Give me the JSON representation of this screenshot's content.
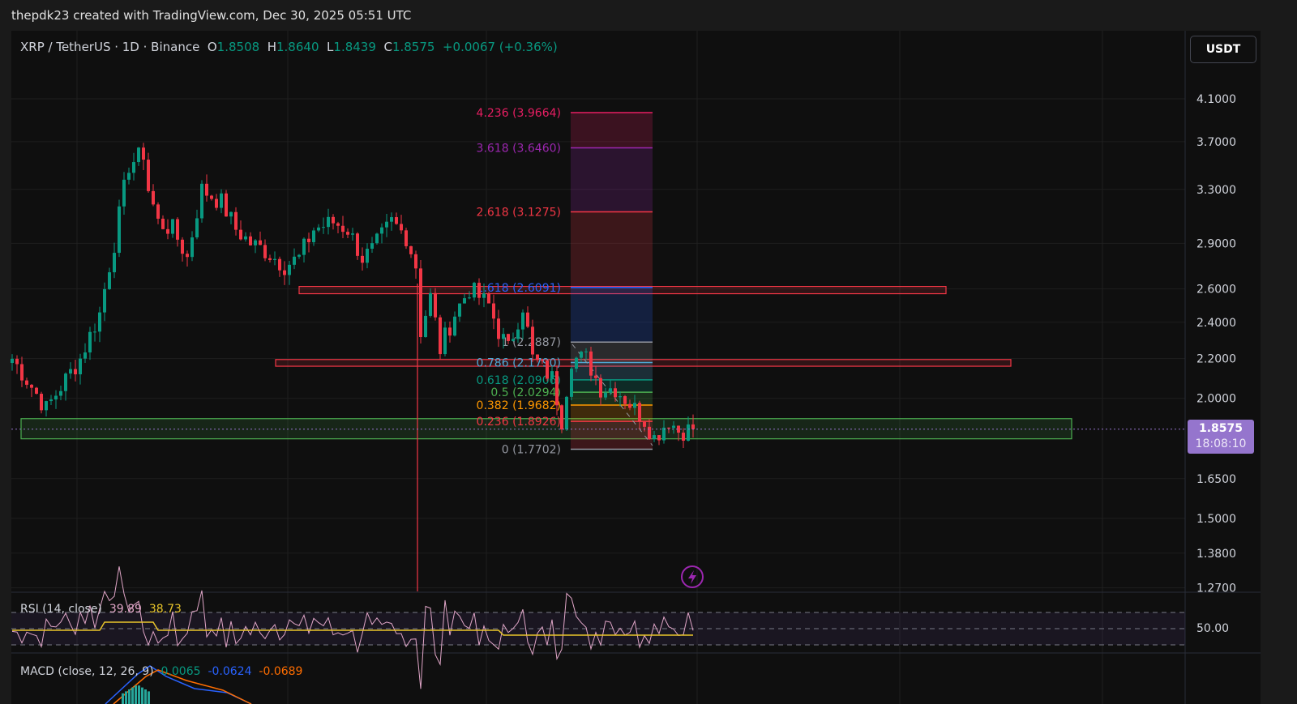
{
  "credit": "thepdk23 created with TradingView.com, Dec 30, 2025 05:51 UTC",
  "legend": {
    "symbol": "XRP / TetherUS · 1D · Binance",
    "o_label": "O",
    "o": "1.8508",
    "h_label": "H",
    "h": "1.8640",
    "l_label": "L",
    "l": "1.8439",
    "c_label": "C",
    "c": "1.8575",
    "change": "+0.0067 (+0.36%)"
  },
  "currency_button": "USDT",
  "price_tag": {
    "price": "1.8575",
    "countdown": "18:08:10"
  },
  "rsi": {
    "label": "RSI (14, close)",
    "value": "39.89",
    "ma": "38.73",
    "axis": "50.00"
  },
  "macd": {
    "label": "MACD (close, 12, 26, 9)",
    "hist": "0.0065",
    "macd": "-0.0624",
    "signal": "-0.0689"
  },
  "colors": {
    "up": "#089981",
    "down": "#f23645",
    "rsi": "#e1a6c8",
    "rsi_ma": "#e9c52a",
    "macd": "#2962ff",
    "signal": "#ff6d00"
  },
  "chart_data": {
    "type": "candlestick",
    "title": "XRP / TetherUS · 1D · Binance",
    "scale": "log",
    "y_ticks": [
      "4.1000",
      "3.7000",
      "3.3000",
      "2.9000",
      "2.6000",
      "2.4000",
      "2.2000",
      "2.0000",
      "1.6500",
      "1.5000",
      "1.3800",
      "1.2700"
    ],
    "ylim": [
      1.25,
      4.3
    ],
    "close_keyframes": [
      [
        0,
        2.2
      ],
      [
        7,
        1.95
      ],
      [
        14,
        2.2
      ],
      [
        18,
        2.45
      ],
      [
        21,
        2.9
      ],
      [
        24,
        3.5
      ],
      [
        27,
        3.6
      ],
      [
        28,
        3.3
      ],
      [
        30,
        3.05
      ],
      [
        33,
        3.0
      ],
      [
        36,
        2.8
      ],
      [
        39,
        3.3
      ],
      [
        43,
        3.2
      ],
      [
        46,
        3.0
      ],
      [
        49,
        2.9
      ],
      [
        52,
        2.85
      ],
      [
        56,
        2.75
      ],
      [
        59,
        2.8
      ],
      [
        62,
        3.0
      ],
      [
        66,
        3.05
      ],
      [
        69,
        3.0
      ],
      [
        72,
        2.8
      ],
      [
        74,
        2.85
      ],
      [
        78,
        3.05
      ],
      [
        81,
        2.95
      ],
      [
        83,
        2.75
      ],
      [
        84,
        2.35
      ],
      [
        86,
        2.55
      ],
      [
        88,
        2.25
      ],
      [
        91,
        2.45
      ],
      [
        94,
        2.6
      ],
      [
        98,
        2.5
      ],
      [
        100,
        2.35
      ],
      [
        102,
        2.25
      ],
      [
        105,
        2.5
      ],
      [
        107,
        2.2
      ],
      [
        111,
        2.1
      ],
      [
        113,
        1.9
      ],
      [
        115,
        2.2
      ],
      [
        118,
        2.2
      ],
      [
        121,
        2.05
      ],
      [
        124,
        2.05
      ],
      [
        128,
        1.95
      ],
      [
        130,
        1.9
      ],
      [
        132,
        1.82
      ],
      [
        135,
        1.9
      ],
      [
        137,
        1.85
      ],
      [
        140,
        1.8575
      ]
    ],
    "fib_extension": [
      {
        "label": "4.236 (3.9664)",
        "price": 3.9664,
        "color": "#e91e63"
      },
      {
        "label": "3.618 (3.6460)",
        "price": 3.646,
        "color": "#9c27b0"
      },
      {
        "label": "2.618 (3.1275)",
        "price": 3.1275,
        "color": "#f23645"
      },
      {
        "label": "1.618 (2.6091)",
        "price": 2.6091,
        "color": "#2962ff"
      },
      {
        "label": "1 (2.2887)",
        "price": 2.2887,
        "color": "#9598a1"
      },
      {
        "label": "0.786 (2.1790)",
        "price": 2.179,
        "color": "#4ea9d6"
      },
      {
        "label": "0.618 (2.0906)",
        "price": 2.0906,
        "color": "#089981"
      },
      {
        "label": "0.5 (2.0294)",
        "price": 2.0294,
        "color": "#4caf50"
      },
      {
        "label": "0.382 (1.9682)",
        "price": 1.9682,
        "color": "#ff9800"
      },
      {
        "label": "0.236 (1.8926)",
        "price": 1.8926,
        "color": "#f23645"
      },
      {
        "label": "0 (1.7702)",
        "price": 1.7702,
        "color": "#9598a1"
      }
    ],
    "zones": [
      {
        "name": "resistance-zone-2.6",
        "from": 2.57,
        "to": 2.615,
        "color": "#f23645"
      },
      {
        "name": "resistance-zone-2.2",
        "from": 2.16,
        "to": 2.195,
        "color": "#f23645"
      },
      {
        "name": "support-zone-1.85",
        "from": 1.815,
        "to": 1.905,
        "color": "#4caf50"
      }
    ]
  }
}
